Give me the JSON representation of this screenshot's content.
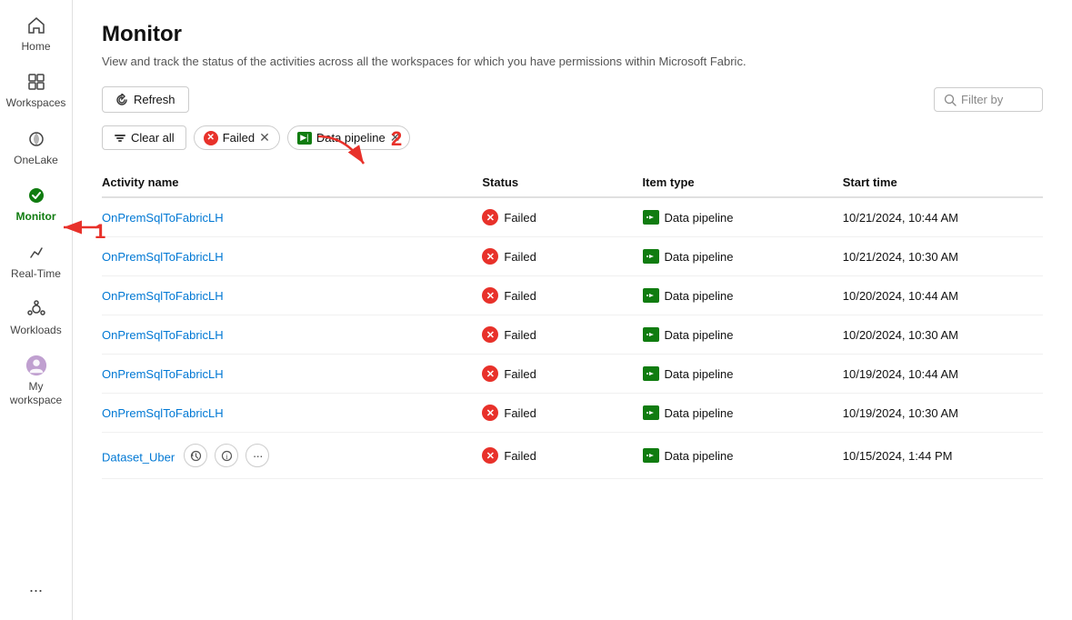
{
  "sidebar": {
    "items": [
      {
        "id": "home",
        "label": "Home",
        "icon": "⌂",
        "active": false
      },
      {
        "id": "workspaces",
        "label": "Workspaces",
        "icon": "▣",
        "active": false
      },
      {
        "id": "onelake",
        "label": "OneLake",
        "icon": "◎",
        "active": false
      },
      {
        "id": "monitor",
        "label": "Monitor",
        "icon": "●",
        "active": true
      },
      {
        "id": "realtime",
        "label": "Real-Time",
        "icon": "⚡",
        "active": false
      },
      {
        "id": "workloads",
        "label": "Workloads",
        "icon": "◈",
        "active": false
      },
      {
        "id": "myworkspace",
        "label": "My workspace",
        "icon": "👤",
        "active": false
      }
    ],
    "more_label": "..."
  },
  "page": {
    "title": "Monitor",
    "subtitle": "View and track the status of the activities across all the workspaces for which you have permissions within Microsoft Fabric."
  },
  "toolbar": {
    "refresh_label": "Refresh",
    "clear_all_label": "Clear all",
    "filter_placeholder": "Filter by",
    "chips": [
      {
        "id": "failed",
        "label": "Failed",
        "icon_type": "failed"
      },
      {
        "id": "pipeline",
        "label": "Data pipeline",
        "icon_type": "pipeline"
      }
    ]
  },
  "table": {
    "columns": [
      {
        "id": "name",
        "label": "Activity name"
      },
      {
        "id": "status",
        "label": "Status"
      },
      {
        "id": "type",
        "label": "Item type"
      },
      {
        "id": "time",
        "label": "Start time"
      }
    ],
    "rows": [
      {
        "id": 1,
        "name": "OnPremSqlToFabricLH",
        "status": "Failed",
        "type": "Data pipeline",
        "start_time": "10/21/2024, 10:44 AM",
        "has_actions": false
      },
      {
        "id": 2,
        "name": "OnPremSqlToFabricLH",
        "status": "Failed",
        "type": "Data pipeline",
        "start_time": "10/21/2024, 10:30 AM",
        "has_actions": false
      },
      {
        "id": 3,
        "name": "OnPremSqlToFabricLH",
        "status": "Failed",
        "type": "Data pipeline",
        "start_time": "10/20/2024, 10:44 AM",
        "has_actions": false
      },
      {
        "id": 4,
        "name": "OnPremSqlToFabricLH",
        "status": "Failed",
        "type": "Data pipeline",
        "start_time": "10/20/2024, 10:30 AM",
        "has_actions": false
      },
      {
        "id": 5,
        "name": "OnPremSqlToFabricLH",
        "status": "Failed",
        "type": "Data pipeline",
        "start_time": "10/19/2024, 10:44 AM",
        "has_actions": false
      },
      {
        "id": 6,
        "name": "OnPremSqlToFabricLH",
        "status": "Failed",
        "type": "Data pipeline",
        "start_time": "10/19/2024, 10:30 AM",
        "has_actions": false
      },
      {
        "id": 7,
        "name": "Dataset_Uber",
        "status": "Failed",
        "type": "Data pipeline",
        "start_time": "10/15/2024, 1:44 PM",
        "has_actions": true
      }
    ]
  },
  "annotations": {
    "arrow1_label": "1",
    "arrow2_label": "2"
  }
}
